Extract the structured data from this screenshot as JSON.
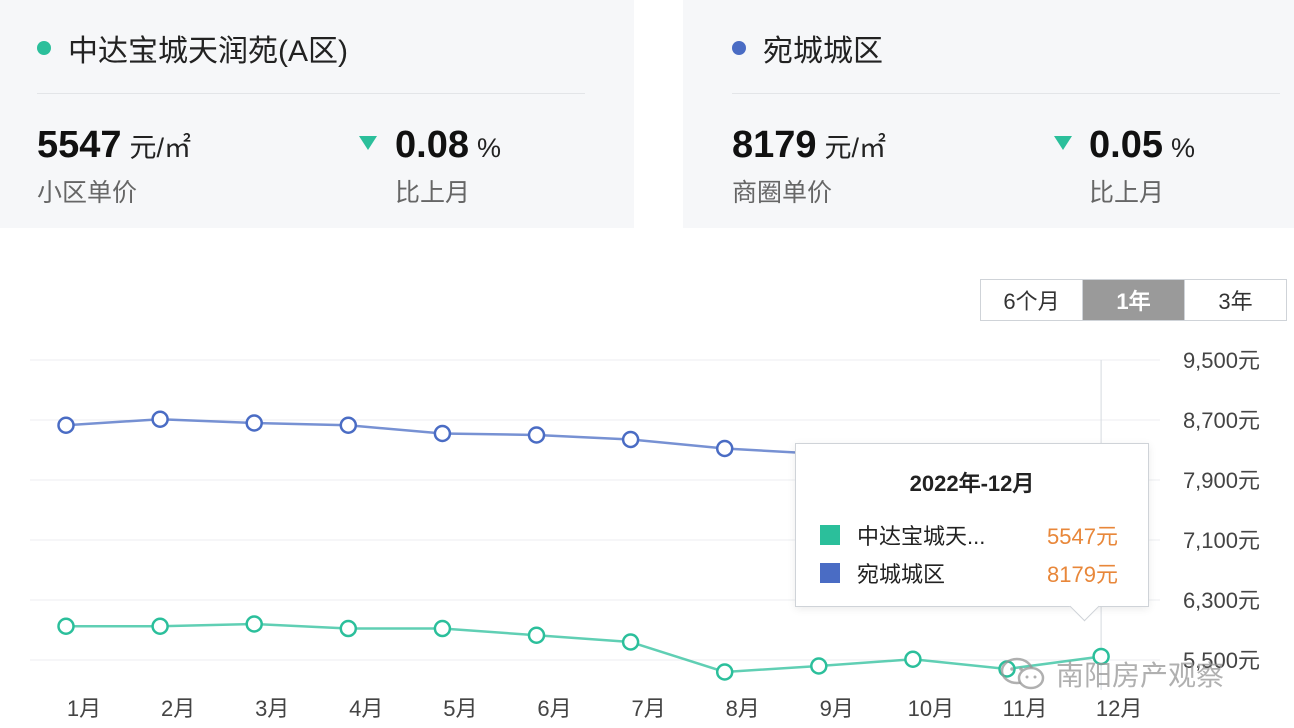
{
  "cards": [
    {
      "name": "中达宝城天润苑(A区)",
      "color": "#2bbf9b",
      "price": "5547",
      "unit": "元/㎡",
      "price_label": "小区单价",
      "change": "0.08",
      "change_unit": "%",
      "change_label": "比上月",
      "change_direction": "down"
    },
    {
      "name": "宛城城区",
      "color": "#4a6cc4",
      "price": "8179",
      "unit": "元/㎡",
      "price_label": "商圈单价",
      "change": "0.05",
      "change_unit": "%",
      "change_label": "比上月",
      "change_direction": "down"
    }
  ],
  "range_tabs": [
    "6个月",
    "1年",
    "3年"
  ],
  "range_selected": "1年",
  "tooltip": {
    "title": "2022年-12月",
    "rows": [
      {
        "name": "中达宝城天...",
        "value": "5547元",
        "color": "#2bbf9b"
      },
      {
        "name": "宛城城区",
        "value": "8179元",
        "color": "#4a6cc4"
      }
    ]
  },
  "watermark": "南阳房产观察",
  "chart_data": {
    "type": "line",
    "categories": [
      "1月",
      "2月",
      "3月",
      "4月",
      "5月",
      "6月",
      "7月",
      "8月",
      "9月",
      "10月",
      "11月",
      "12月"
    ],
    "series": [
      {
        "name": "宛城城区",
        "color": "#4a6cc4",
        "values": [
          8630,
          8710,
          8660,
          8630,
          8520,
          8500,
          8440,
          8320,
          8250,
          8220,
          8200,
          8179
        ]
      },
      {
        "name": "中达宝城天润苑(A区)",
        "color": "#2bbf9b",
        "values": [
          5950,
          5950,
          5980,
          5920,
          5920,
          5830,
          5740,
          5340,
          5420,
          5510,
          5380,
          5547
        ]
      }
    ],
    "y_ticks": [
      "9,500元",
      "8,700元",
      "7,900元",
      "7,100元",
      "6,300元",
      "5,500元"
    ],
    "ylim": [
      5500,
      9500
    ],
    "y_axis_position": "right",
    "grid": true,
    "tooltip_category": "12月"
  }
}
